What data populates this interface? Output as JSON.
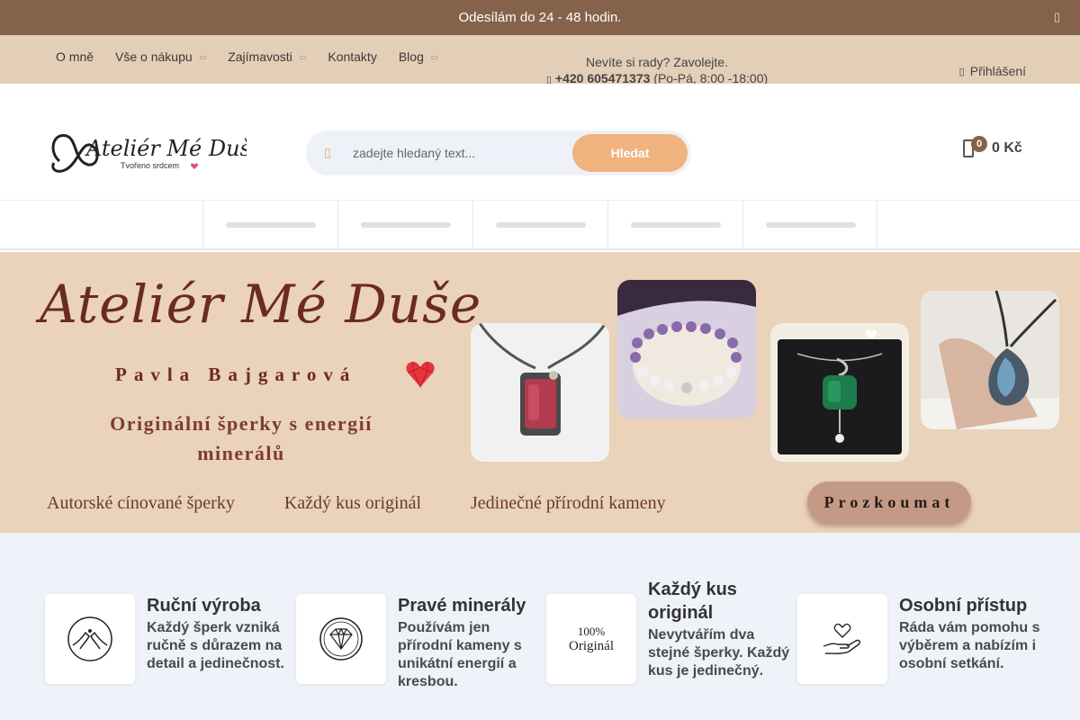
{
  "announcement": {
    "text": "Odesílám do 24 - 48 hodin.",
    "close_label": "▯"
  },
  "topnav": {
    "items": [
      {
        "label": "O mně",
        "has_dropdown": false
      },
      {
        "label": "Vše o nákupu",
        "has_dropdown": true
      },
      {
        "label": "Zajímavosti",
        "has_dropdown": true
      },
      {
        "label": "Kontakty",
        "has_dropdown": false
      },
      {
        "label": "Blog",
        "has_dropdown": true
      }
    ],
    "help_text": "Nevíte si rady? Zavolejte.",
    "phone": "+420 605471373",
    "hours": "(Po-Pá, 8:00 -18:00)",
    "login_label": "Přihlášení"
  },
  "header": {
    "logo_text": "Ateliér Mé Duše",
    "logo_sub": "Tvořeno srdcem",
    "search_placeholder": "zadejte hledaný text...",
    "search_button": "Hledat",
    "cart_count": "0",
    "cart_total": "0 Kč"
  },
  "hero": {
    "title": "Ateliér Mé Duše",
    "name": "Pavla Bajgarová",
    "tagline": "Originální šperky s energií minerálů",
    "features": [
      "Autorské cínované šperky",
      "Každý kus originál",
      "Jedinečné přírodní kameny"
    ],
    "cta": "Prozkoumat",
    "accent_color": "#6b2a22"
  },
  "features": [
    {
      "icon": "handmade-icon",
      "title": "Ruční výroba",
      "desc": "Každý šperk vzniká ručně s důrazem na detail a jedinečnost."
    },
    {
      "icon": "gemstone-icon",
      "title": "Pravé minerály",
      "desc": "Používám jen přírodní kameny s unikátní energií a kresbou."
    },
    {
      "icon": "original-icon",
      "title": "Každý kus originál",
      "desc": "Nevytvářím dva stejné šperky. Každý kus je jedinečný.",
      "icon_text_1": "100%",
      "icon_text_2": "Originál"
    },
    {
      "icon": "hand-heart-icon",
      "title": "Osobní přístup",
      "desc": "Ráda vám pomohu s výběrem a nabízím i osobní setkání."
    }
  ]
}
